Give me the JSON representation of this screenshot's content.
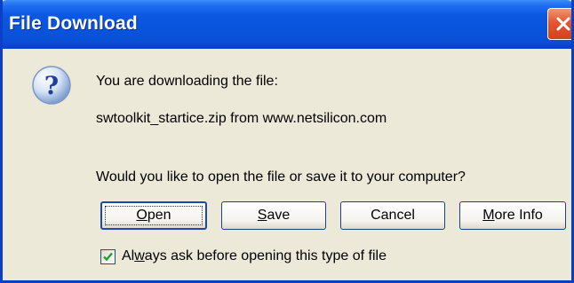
{
  "window": {
    "title": "File Download",
    "icons": {
      "title_close": "close-icon",
      "dialog": "question-icon",
      "checkbox": "check-icon"
    },
    "colors": {
      "titlebar": "#0a54dc",
      "body": "#ece9d8",
      "close_button": "#e4552f",
      "check": "#21a121"
    }
  },
  "message": {
    "line1": "You are downloading the file:",
    "line2": "swtoolkit_startice.zip from www.netsilicon.com",
    "prompt": "Would you like to open the file or save it to your computer?"
  },
  "buttons": {
    "open": {
      "mnemonic": "O",
      "rest": "pen"
    },
    "save": {
      "mnemonic": "S",
      "rest": "ave"
    },
    "cancel": {
      "label": "Cancel"
    },
    "more_info": {
      "mnemonic": "M",
      "rest": "ore Info"
    }
  },
  "checkbox": {
    "checked": true,
    "label_pre": "Al",
    "label_mnemonic": "w",
    "label_post": "ays ask before opening this type of file"
  }
}
